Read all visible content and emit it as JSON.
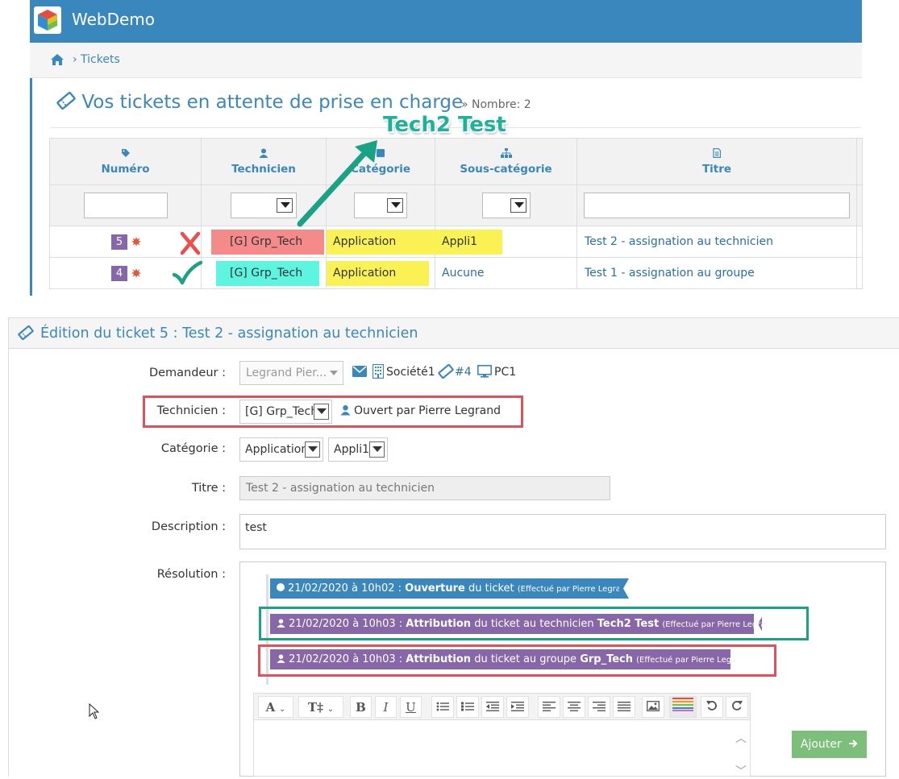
{
  "app": {
    "title": "WebDemo"
  },
  "breadcrumb": {
    "crumb": "› Tickets"
  },
  "page": {
    "title": "Vos tickets en attente de prise en charge",
    "count": "» Nombre: 2"
  },
  "annotation": {
    "text": "Tech2 Test"
  },
  "table": {
    "headers": [
      "Numéro",
      "Technicien",
      "Catégorie",
      "Sous-catégorie",
      "Titre"
    ],
    "rows": [
      {
        "number": "5",
        "technicien": "[G] Grp_Tech",
        "categorie": "Application",
        "souscategorie": "Appli1",
        "titre": "Test 2 - assignation au technicien"
      },
      {
        "number": "4",
        "technicien": "[G] Grp_Tech",
        "categorie": "Application",
        "souscategorie": "Aucune",
        "titre": "Test 1 - assignation au groupe"
      }
    ]
  },
  "edit": {
    "title": "Édition du ticket 5 : Test 2 - assignation au technicien",
    "demandeur": {
      "label": "Demandeur :",
      "value": "Legrand Pier...",
      "societe": "Société1",
      "ticket_ref": "#4",
      "pc": "PC1"
    },
    "technicien": {
      "label": "Technicien :",
      "value": "[G] Grp_Tech",
      "opened_by": "Ouvert par Pierre Legrand"
    },
    "categorie": {
      "label": "Catégorie :",
      "value": "Application",
      "sub_value": "Appli1"
    },
    "titre": {
      "label": "Titre :",
      "value": "Test 2 - assignation au technicien"
    },
    "description": {
      "label": "Description :",
      "value": "test"
    },
    "resolution": {
      "label": "Résolution :",
      "timeline": [
        {
          "date": "21/02/2020 à 10h02 :",
          "action": "Ouverture",
          "text": " du ticket ",
          "target": "",
          "by": "(Effectué par Pierre Legrand)"
        },
        {
          "date": "21/02/2020 à 10h03 :",
          "action": "Attribution",
          "text": " du ticket au technicien ",
          "target": "Tech2 Test",
          "by": "(Effectué par Pierre Legrand)"
        },
        {
          "date": "21/02/2020 à 10h03 :",
          "action": "Attribution",
          "text": " du ticket au groupe ",
          "target": "Grp_Tech",
          "by": "(Effectué par Pierre Legrand)"
        }
      ]
    },
    "toolbar": {
      "font": "A",
      "size": "T‡",
      "bold": "B",
      "italic": "I",
      "underline": "U"
    },
    "submit": "Ajouter"
  },
  "colors": {
    "primary": "#3a87be",
    "purple": "#8867a8",
    "highlight_red": "#f58a8a",
    "highlight_cyan": "#5ef5e0",
    "highlight_yellow": "#faf155",
    "annotation_green": "#1db39a",
    "success_button": "#7cbf7a"
  }
}
